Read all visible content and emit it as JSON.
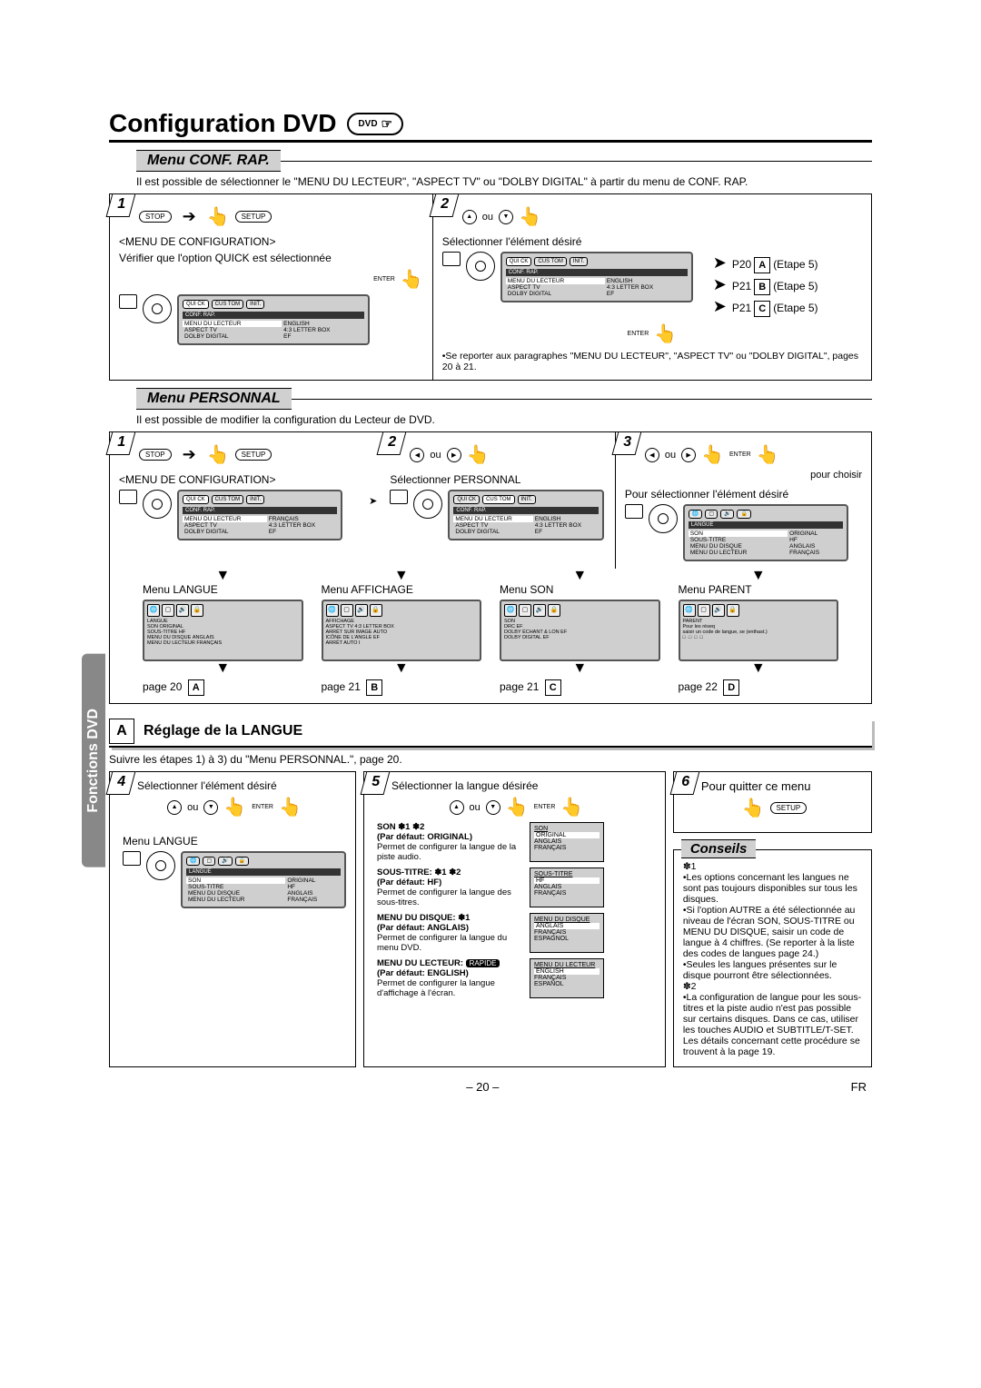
{
  "title": "Configuration DVD",
  "dvd_badge": "DVD",
  "section1": {
    "heading": "Menu CONF. RAP.",
    "intro": "Il est possible de sélectionner le \"MENU DU LECTEUR\", \"ASPECT TV\" ou \"DOLBY DIGITAL\" à partir du menu de CONF. RAP.",
    "step1": {
      "btn_stop": "STOP",
      "btn_setup": "SETUP",
      "menu_title": "<MENU DE CONFIGURATION>",
      "verify": "Vérifier que l'option QUICK est sélectionnée",
      "enter": "ENTER",
      "osd_bar": "CONF. RAP.",
      "osd_tabs": [
        "QUI\nCK",
        "CUS\nTOM",
        "INIT."
      ],
      "osd_rows": [
        [
          "MENU DU LECTEUR",
          "ENGLISH"
        ],
        [
          "ASPECT TV",
          "4:3 LETTER BOX"
        ],
        [
          "DOLBY DIGITAL",
          "EF"
        ]
      ]
    },
    "step2": {
      "ou": "ou",
      "select": "Sélectionner l'élément désiré",
      "osd_bar": "CONF. RAP.",
      "osd_rows": [
        [
          "MENU DU LECTEUR",
          "ENGLISH"
        ],
        [
          "ASPECT TV",
          "4:3 LETTER BOX"
        ],
        [
          "DOLBY DIGITAL",
          "EF"
        ]
      ],
      "refs": [
        {
          "page": "P20",
          "box": "A",
          "etape": "(Etape 5)"
        },
        {
          "page": "P21",
          "box": "B",
          "etape": "(Etape 5)"
        },
        {
          "page": "P21",
          "box": "C",
          "etape": "(Etape 5)"
        }
      ],
      "enter": "ENTER",
      "note": "Se reporter aux paragraphes \"MENU DU LECTEUR\", \"ASPECT TV\" ou \"DOLBY DIGITAL\", pages 20 à 21."
    }
  },
  "section2": {
    "heading": "Menu PERSONNAL",
    "intro": "Il est possible de modifier la configuration du Lecteur de DVD.",
    "step1": {
      "btn_stop": "STOP",
      "btn_setup": "SETUP",
      "menu_title": "<MENU DE CONFIGURATION>",
      "osd_bar": "CONF. RAP.",
      "osd_rows": [
        [
          "MENU DU LECTEUR",
          "FRANÇAIS"
        ],
        [
          "ASPECT TV",
          "4:3 LETTER BOX"
        ],
        [
          "DOLBY DIGITAL",
          "EF"
        ]
      ]
    },
    "step2": {
      "ou": "ou",
      "select": "Sélectionner PERSONNAL",
      "osd_bar": "CONF. RAP.",
      "osd_rows": [
        [
          "MENU DU LECTEUR",
          "ENGLISH"
        ],
        [
          "ASPECT TV",
          "4:3 LETTER BOX"
        ],
        [
          "DOLBY DIGITAL",
          "EF"
        ]
      ]
    },
    "step3": {
      "ou": "ou",
      "enter": "ENTER",
      "pour": "pour choisir",
      "select": "Pour sélectionner l'élément désiré",
      "osd_bar": "LANGUE",
      "osd_rows": [
        [
          "SON",
          "ORIGINAL"
        ],
        [
          "SOUS-TITRE",
          "HF"
        ],
        [
          "MENU DU DISQUE",
          "ANGLAIS"
        ],
        [
          "MENU DU LECTEUR",
          "FRANÇAIS"
        ]
      ]
    },
    "thumbs": [
      {
        "title": "Menu LANGUE",
        "bar": "LANGUE",
        "rows": [
          [
            "SON",
            "ORIGINAL"
          ],
          [
            "SOUS-TITRE",
            "HF"
          ],
          [
            "MENU DU DISQUE",
            "ANGLAIS"
          ],
          [
            "MENU DU LECTEUR",
            "FRANÇAIS"
          ]
        ],
        "page": "page 20",
        "box": "A"
      },
      {
        "title": "Menu AFFICHAGE",
        "bar": "AFFICHAGE",
        "rows": [
          [
            "ASPECT TV",
            "4:3 LETTER BOX"
          ],
          [
            "ARRÊT SUR IMAGE",
            "AUTO"
          ],
          [
            "ICÔNE DE L'ANGLE",
            "EF"
          ],
          [
            "ARRÊT AUTO",
            "I"
          ]
        ],
        "page": "page 21",
        "box": "B"
      },
      {
        "title": "Menu SON",
        "bar": "SON",
        "rows": [
          [
            "DRC",
            "EF"
          ],
          [
            "DOLBY ÉCHANT & LON",
            "EF"
          ],
          [
            "DOLBY DIGITAL",
            "EF"
          ]
        ],
        "page": "page 21",
        "box": "C"
      },
      {
        "title": "Menu PARENT",
        "bar": "PARENT",
        "rows": [
          [
            "Pour les réseq",
            ""
          ],
          [
            "saisir un code de langue, se (enthast.)",
            ""
          ]
        ],
        "code": "□□□□",
        "page": "page 22",
        "box": "D"
      }
    ]
  },
  "sectionA": {
    "box": "A",
    "title": "Réglage de la LANGUE",
    "follow": "Suivre les étapes 1) à 3) du \"Menu PERSONNAL.\", page 20.",
    "step4": {
      "title": "Sélectionner l'élément désiré",
      "ou": "ou",
      "enter": "ENTER",
      "menu_label": "Menu LANGUE",
      "osd_bar": "LANGUE",
      "osd_rows": [
        [
          "SON",
          "ORIGINAL"
        ],
        [
          "SOUS-TITRE",
          "HF"
        ],
        [
          "MENU DU DISQUE",
          "ANGLAIS"
        ],
        [
          "MENU DU LECTEUR",
          "FRANÇAIS"
        ]
      ]
    },
    "step5": {
      "title": "Sélectionner la langue désirée",
      "ou": "ou",
      "enter": "ENTER",
      "items": [
        {
          "h": "SON ✽1 ✽2",
          "def": "(Par défaut: ORIGINAL)",
          "desc": "Permet de configurer la langue de la piste audio.",
          "list_title": "SON",
          "list": [
            "ORIGINAL",
            "ANGLAIS",
            "FRANÇAIS"
          ]
        },
        {
          "h": "SOUS-TITRE: ✽1 ✽2",
          "def": "(Par défaut: HF)",
          "desc": "Permet de configurer la langue des sous-titres.",
          "list_title": "SOUS-TITRE",
          "list": [
            "HF",
            "ANGLAIS",
            "FRANÇAIS"
          ]
        },
        {
          "h": "MENU DU DISQUE: ✽1",
          "def": "(Par défaut: ANGLAIS)",
          "desc": "Permet de configurer la langue du menu DVD.",
          "list_title": "MENU DU DISQUE",
          "list": [
            "ANGLAIS",
            "FRANÇAIS",
            "ESPAGNOL"
          ]
        },
        {
          "h": "MENU DU LECTEUR:",
          "chip": "RAPIDE",
          "def": "(Par défaut: ENGLISH)",
          "desc": "Permet de configurer la langue d'affichage à l'écran.",
          "list_title": "MENU DU LECTEUR",
          "list": [
            "ENGLISH",
            "FRANÇAIS",
            "ESPAÑOL"
          ]
        }
      ]
    },
    "step6": {
      "title": "Pour quitter ce menu",
      "btn_setup": "SETUP"
    }
  },
  "conseils": {
    "title": "Conseils",
    "n1": "✽1",
    "b1": "Les options concernant les langues ne sont pas toujours disponibles sur tous les disques.",
    "b2": "Si l'option AUTRE a été sélectionnée au niveau de l'écran SON, SOUS-TITRE ou MENU DU DISQUE, saisir un code de langue à 4 chiffres. (Se reporter à la liste des codes de langues page 24.)",
    "b3": "Seules les langues présentes sur le disque pourront être sélectionnées.",
    "n2": "✽2",
    "b4": "La configuration de langue pour les sous-titres et la piste audio n'est pas possible sur certains disques. Dans ce cas, utiliser les touches AUDIO et SUBTITLE/T-SET. Les détails concernant cette procédure se trouvent à la page 19."
  },
  "side_tab": "Fonctions DVD",
  "footer": {
    "page": "– 20 –",
    "region": "FR"
  }
}
